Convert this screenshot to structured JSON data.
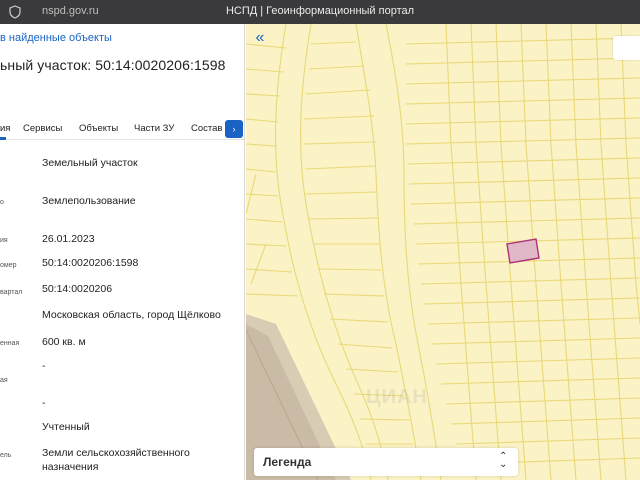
{
  "browser": {
    "url": "nspd.gov.ru",
    "title": "НСПД | Геоинформационный портал"
  },
  "panel": {
    "back_link": "в найденные объекты",
    "heading": "ьный участок: 50:14:0020206:1598",
    "tabs": [
      {
        "label": "ия"
      },
      {
        "label": "Сервисы"
      },
      {
        "label": "Объекты"
      },
      {
        "label": "Части ЗУ"
      },
      {
        "label": "Состав"
      }
    ],
    "tabs_next": "›",
    "rows": [
      {
        "label": "",
        "value": "Земельный участок"
      },
      {
        "label": "о",
        "value": "Землепользование"
      },
      {
        "label": "ия",
        "value": "26.01.2023"
      },
      {
        "label": "омер",
        "value": "50:14:0020206:1598"
      },
      {
        "label": "вартал",
        "value": "50:14:0020206"
      },
      {
        "label": "",
        "value": "Московская область, город Щёлково"
      },
      {
        "label": "енная",
        "value": "600 кв. м"
      },
      {
        "label": "ая",
        "value": "-"
      },
      {
        "label": "",
        "value": "-"
      },
      {
        "label": "",
        "value": "Учтенный"
      },
      {
        "label": "ель",
        "value": "Земли сельскохозяйственного"
      },
      {
        "label": "",
        "value": "назначения"
      }
    ]
  },
  "map": {
    "collapse_icon": "double-chevron-left-icon",
    "legend_label": "Легенда",
    "watermark": "ЦИАН",
    "colors": {
      "background": "#fbf3c5",
      "parcel_lines": "#e8d87a",
      "highlight_fill": "#e0b8c8",
      "highlight_stroke": "#b0307a",
      "road": "#c9bba5"
    }
  }
}
